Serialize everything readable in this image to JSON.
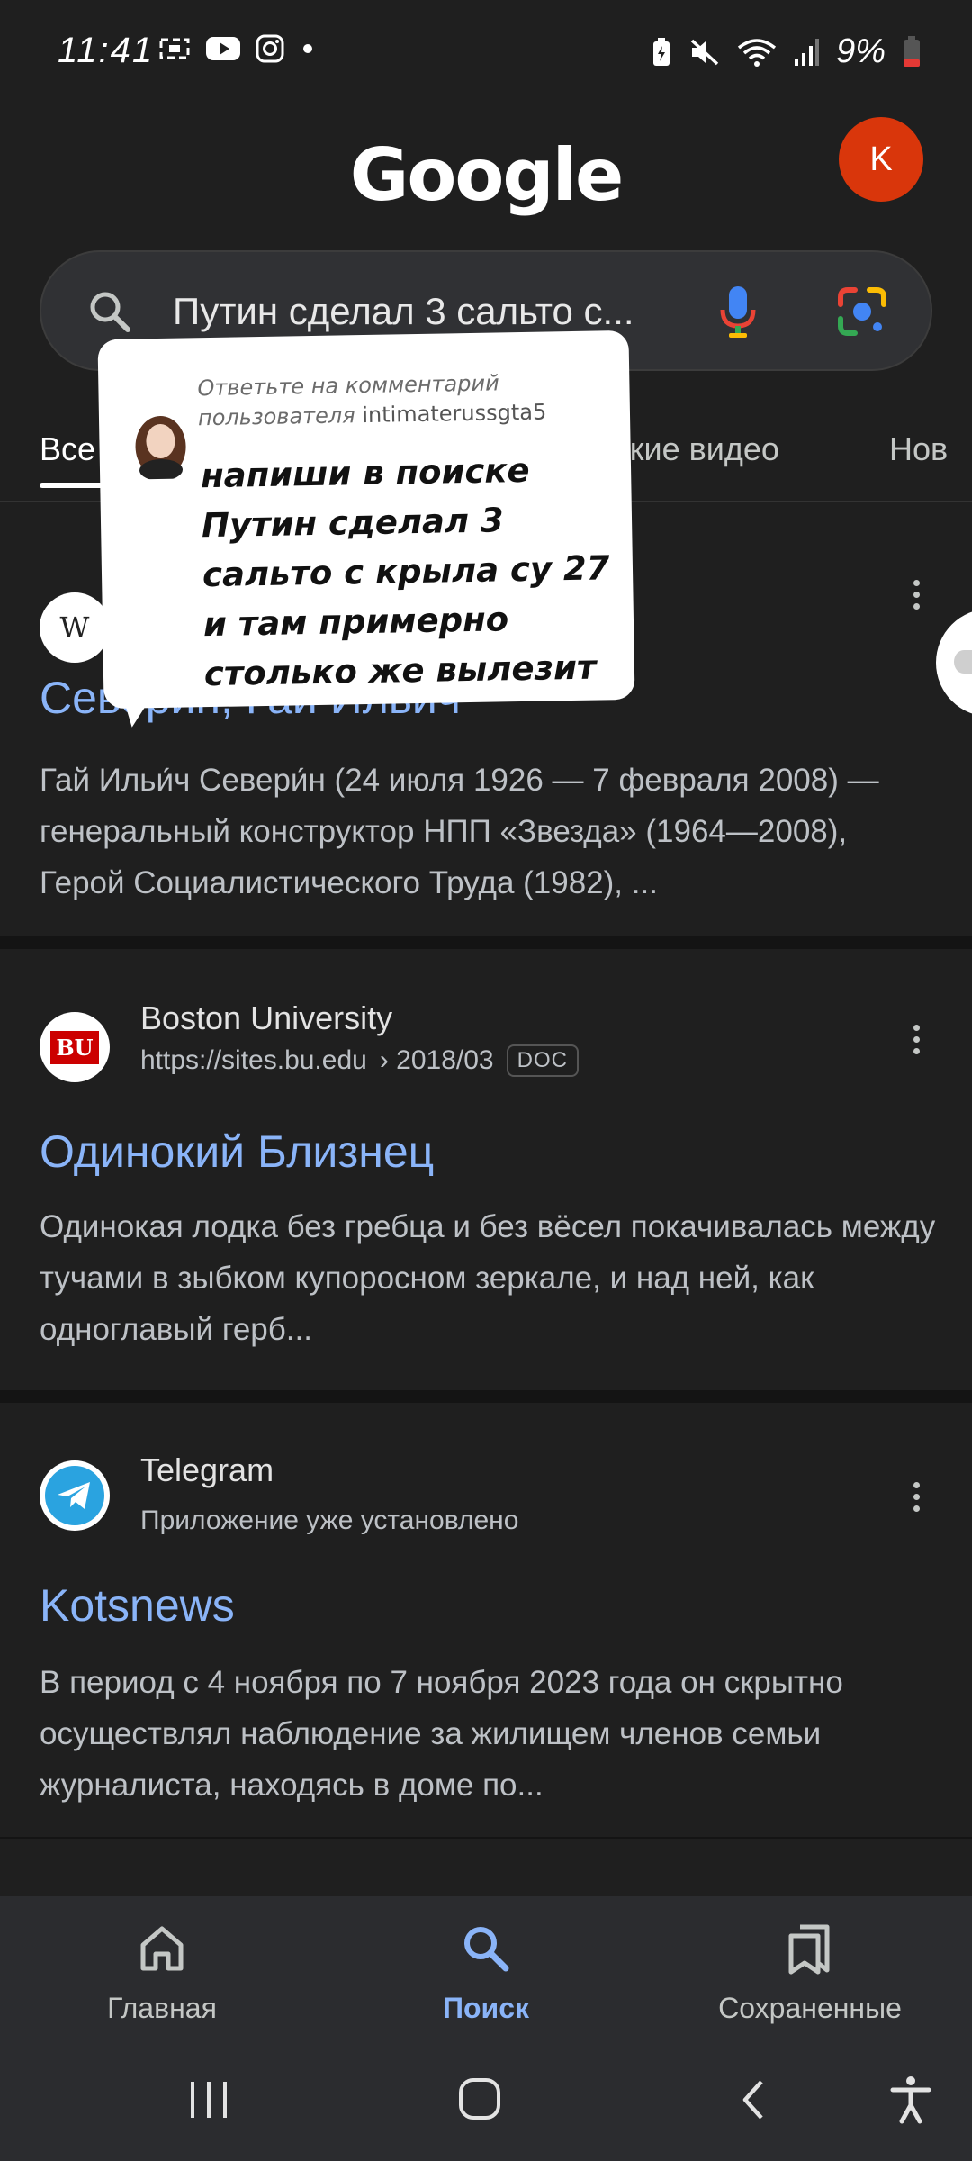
{
  "status_bar": {
    "time": "11:41",
    "battery": "9%",
    "icons": [
      "screen-record-icon",
      "youtube-icon",
      "instagram-icon",
      "dot-icon",
      "battery-saver-icon",
      "mute-icon",
      "wifi-icon",
      "signal-icon",
      "battery-icon"
    ]
  },
  "header": {
    "logo": "Google",
    "avatar_letter": "K"
  },
  "search": {
    "query": "Путин сделал 3 сальто с..."
  },
  "tabs": [
    {
      "label": "Все",
      "active": true
    },
    {
      "label": "Короткие видео",
      "visible_part": "откие видео"
    },
    {
      "label": "Нов"
    }
  ],
  "comment": {
    "reply_prefix": "Ответьте на комментарий пользователя",
    "username": "intimaterussgta5",
    "text": "напиши в поиске Путин сделал 3 сальто с крыла су 27 и там примерно столько же вылезит"
  },
  "results": [
    {
      "favicon": "W",
      "title": "Северин, Гай Ильич",
      "snippet": "Гай Ильи́ч Севери́н (24 июля 1926 — 7 февраля 2008) — генеральный конструктор НПП «Звезда» (1964—2008), Герой Социалистического Труда (1982), ..."
    },
    {
      "favicon": "BU",
      "site": "Boston University",
      "url": "https://sites.bu.edu",
      "url_path": "› 2018/03",
      "badge": "DOC",
      "title": "Одинокий Близнец",
      "snippet": "Одинокая лодка без гребца и без вёсел покачивалась между тучами в зыбком купоросном зеркале, и над ней, как одноглавый герб..."
    },
    {
      "favicon": "telegram-icon",
      "site": "Telegram",
      "url": "Приложение уже установлено",
      "title": "Kotsnews",
      "snippet": "В период с 4 ноября по 7 ноября 2023 года он скрытно осуществлял наблюдение за жилищем членов семьи журналиста, находясь в доме по..."
    }
  ],
  "bottom_nav": [
    {
      "label": "Главная",
      "icon": "home-icon"
    },
    {
      "label": "Поиск",
      "icon": "search-icon",
      "active": true
    },
    {
      "label": "Сохраненные",
      "icon": "saved-icon"
    }
  ],
  "colors": {
    "background": "#1f1f1f",
    "link": "#8ab4f8",
    "avatar": "#d9360b"
  }
}
